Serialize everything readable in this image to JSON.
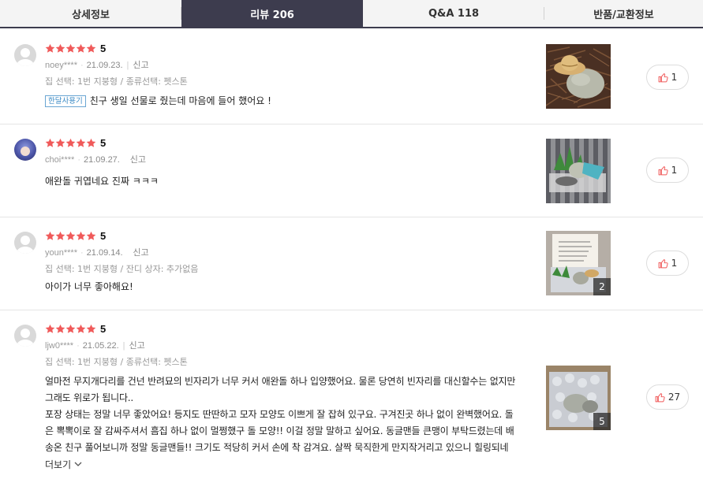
{
  "tabs": [
    {
      "label": "상세정보",
      "active": false
    },
    {
      "label": "리뷰 206",
      "active": true
    },
    {
      "label": "Q&A 118",
      "active": false
    },
    {
      "label": "반품/교환정보",
      "active": false
    }
  ],
  "colors": {
    "tab_active_bg": "#3d3c4e",
    "star": "#f05a5a",
    "badge": "#3a8ac5",
    "like_icon": "#f05a5a"
  },
  "report_label": "신고",
  "more_label": "더보기",
  "reviews": [
    {
      "avatar": "default-avatar",
      "rating": "5",
      "user": "noey****",
      "date": "21.09.23.",
      "options": "집 선택: 1번 지붕형 / 종류선택: 펫스톤",
      "badge": "한달사용기",
      "content": "친구 생일 선물로 줬는데 마음에 들어 했어요 !",
      "likes": "1",
      "photo_count": ""
    },
    {
      "avatar": "profile-avatar",
      "rating": "5",
      "user": "choi****",
      "date": "21.09.27.",
      "options": "",
      "badge": "",
      "content": "애완돌 귀엽네요 진짜 ㅋㅋㅋ",
      "likes": "1",
      "photo_count": ""
    },
    {
      "avatar": "default-avatar",
      "rating": "5",
      "user": "youn****",
      "date": "21.09.14.",
      "options": "집 선택: 1번 지붕형 / 잔디 상자: 추가없음",
      "badge": "",
      "content": "아이가 너무 좋아해요!",
      "likes": "1",
      "photo_count": "2"
    },
    {
      "avatar": "default-avatar",
      "rating": "5",
      "user": "ljw0****",
      "date": "21.05.22.",
      "options": "집 선택: 1번 지붕형 / 종류선택: 펫스톤",
      "badge": "",
      "content_lines": [
        "얼마전 무지개다리를 건넌 반려묘의 빈자리가 너무 커서 애완돌 하나 입양했어요. 물론 당연히 빈자리를 대신할수는 없지만",
        "그래도 위로가 됩니다..",
        "포장 상태는 정말 너무 좋았어요! 등지도 딴딴하고 모자 모양도 이쁘게 잘 잡혀 있구요. 구겨진곳 하나 없이 완벽했어요. 돌",
        "은 뽁뽁이로 잘 감싸주셔서 흠집 하나 없이 멀쩡했구 돌 모양!! 이걸 정말 말하고 싶어요. 동글맨들 큰맹이 부탁드렸는데 배",
        "송온 친구 풀어보니까 정말 동글맨들!! 크기도 적당히 커서 손에 착 감겨요. 살짝 묵직한게 만지작거리고 있으니 힐링되네"
      ],
      "likes": "27",
      "photo_count": "5"
    }
  ]
}
